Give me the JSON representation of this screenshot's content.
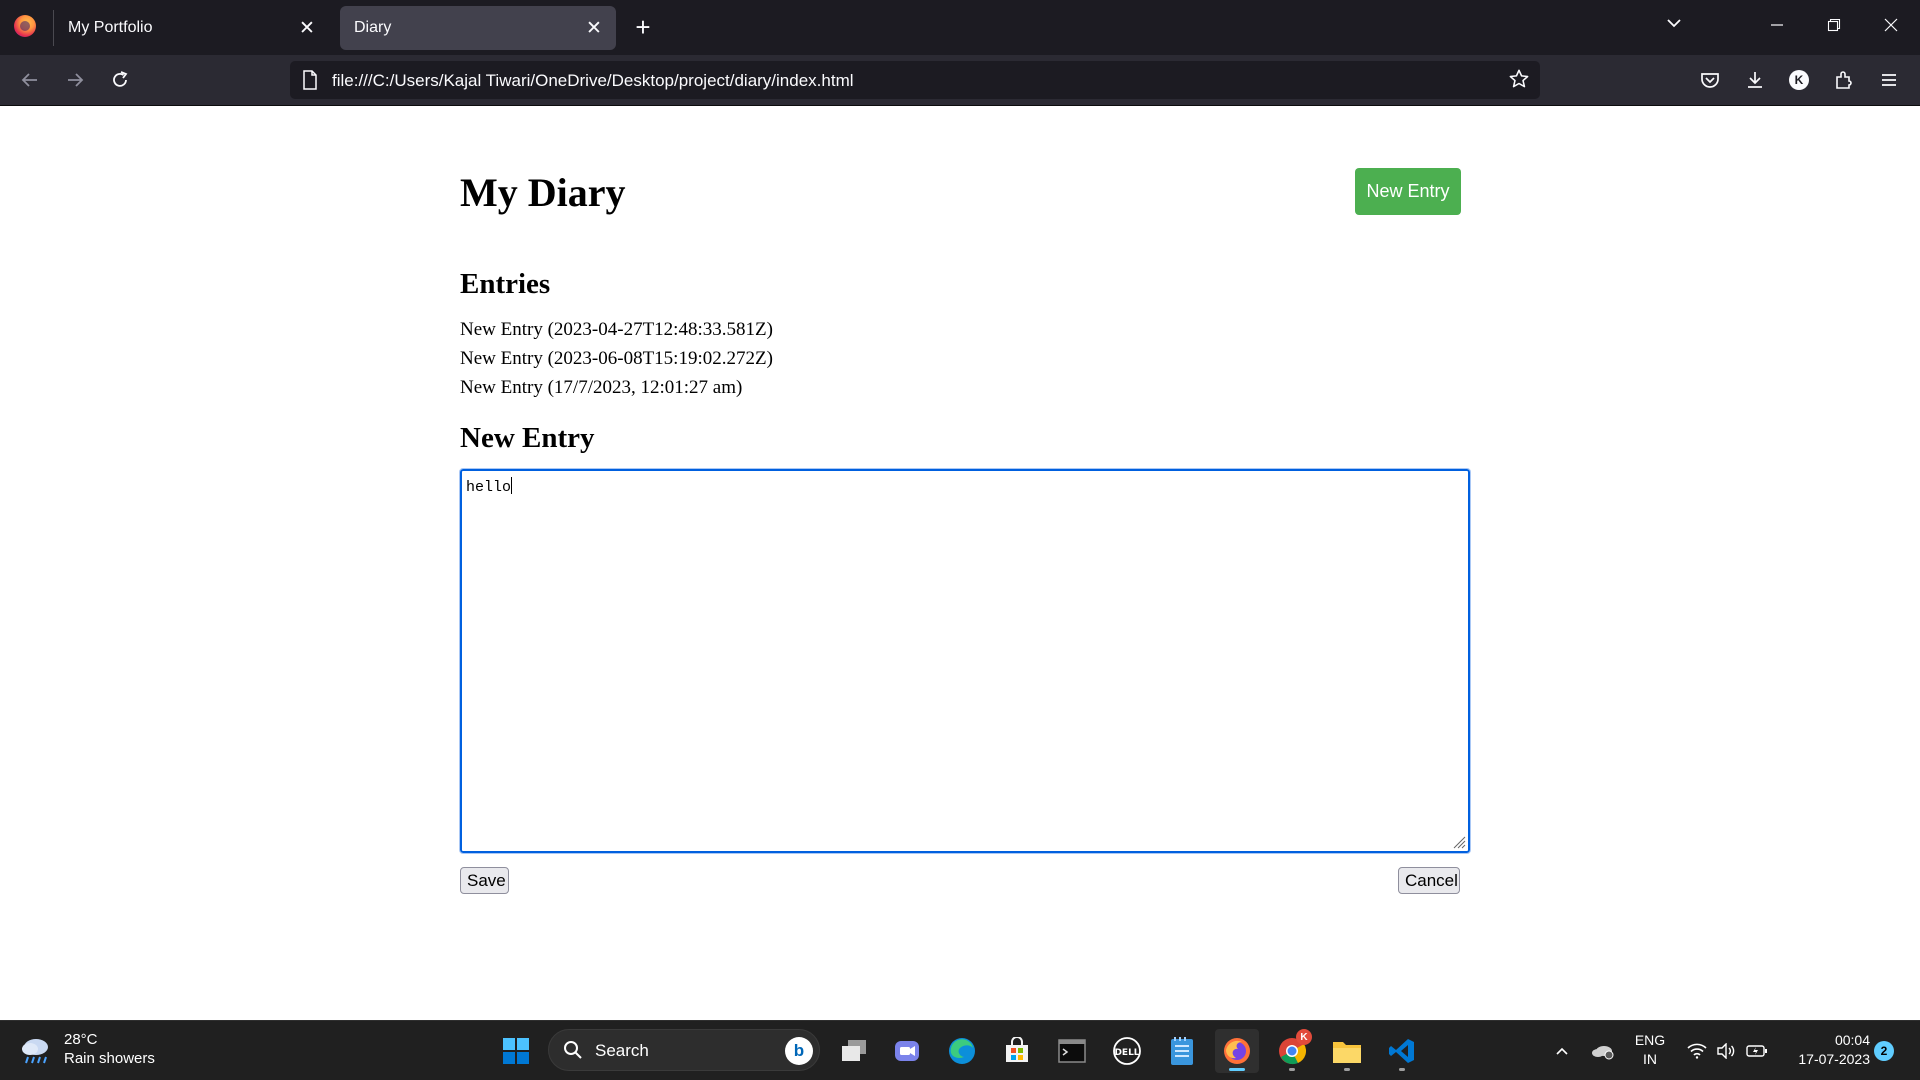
{
  "browser": {
    "tabs": [
      {
        "title": "My Portfolio",
        "active": false
      },
      {
        "title": "Diary",
        "active": true
      }
    ],
    "url": "file:///C:/Users/Kajal Tiwari/OneDrive/Desktop/project/diary/index.html",
    "account_initial": "K",
    "icons": [
      "firefox-logo",
      "close-icon",
      "plus-icon",
      "chevron-down-icon",
      "minimize-icon",
      "restore-icon",
      "back-arrow-icon",
      "forward-arrow-icon",
      "reload-icon",
      "page-icon",
      "star-icon",
      "pocket-icon",
      "download-icon",
      "extensions-icon",
      "menu-icon"
    ]
  },
  "page": {
    "title": "My Diary",
    "new_entry_button": "New Entry",
    "entries_heading": "Entries",
    "entries": [
      "New Entry (2023-04-27T12:48:33.581Z)",
      "New Entry (2023-06-08T15:19:02.272Z)",
      "New Entry (17/7/2023, 12:01:27 am)"
    ],
    "new_entry_heading": "New Entry",
    "textarea_value": "hello",
    "save_button": "Save",
    "cancel_button": "Cancel",
    "accent_color": "#4caf50"
  },
  "taskbar": {
    "weather": {
      "temp": "28°C",
      "desc": "Rain showers"
    },
    "search_label": "Search",
    "search_badge": "b",
    "language": {
      "line1": "ENG",
      "line2": "IN"
    },
    "clock": {
      "time": "00:04",
      "date": "17-07-2023"
    },
    "notification_count": "2",
    "chrome_badge": "K",
    "apps": [
      "start",
      "search",
      "task-view",
      "teams",
      "edge",
      "store",
      "terminal",
      "dell",
      "notepad",
      "firefox",
      "chrome",
      "file-explorer",
      "vscode"
    ]
  }
}
